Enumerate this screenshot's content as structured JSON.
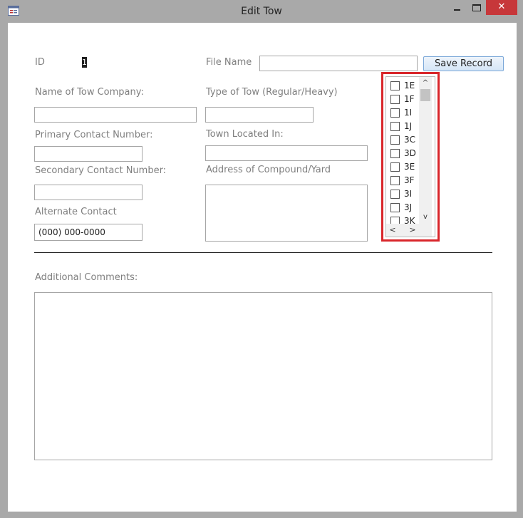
{
  "window": {
    "title": "Edit Tow",
    "close_glyph": "✕"
  },
  "form": {
    "id_label": "ID",
    "id_value": "1",
    "file_name_label": "File Name",
    "save_button": "Save Record",
    "tow_company_label": "Name of Tow Company:",
    "tow_type_label": "Type of Tow (Regular/Heavy)",
    "primary_contact_label": "Primary Contact Number:",
    "town_label": "Town Located In:",
    "secondary_contact_label": "Secondary Contact Number:",
    "address_label": "Address of Compound/Yard",
    "alternate_contact_label": "Alternate Contact",
    "alternate_contact_value": "(000) 000-0000",
    "comments_label": "Additional Comments:"
  },
  "list": {
    "items": [
      {
        "label": "1E",
        "checked": false
      },
      {
        "label": "1F",
        "checked": false
      },
      {
        "label": "1I",
        "checked": false
      },
      {
        "label": "1J",
        "checked": false
      },
      {
        "label": "3C",
        "checked": false
      },
      {
        "label": "3D",
        "checked": false
      },
      {
        "label": "3E",
        "checked": false
      },
      {
        "label": "3F",
        "checked": false
      },
      {
        "label": "3I",
        "checked": false
      },
      {
        "label": "3J",
        "checked": false
      },
      {
        "label": "3K",
        "checked": false
      }
    ],
    "up_glyph": "^",
    "down_glyph": "v",
    "left_glyph": "<",
    "right_glyph": ">"
  },
  "colors": {
    "highlight": "#d9262b",
    "close_button": "#c7373a"
  }
}
